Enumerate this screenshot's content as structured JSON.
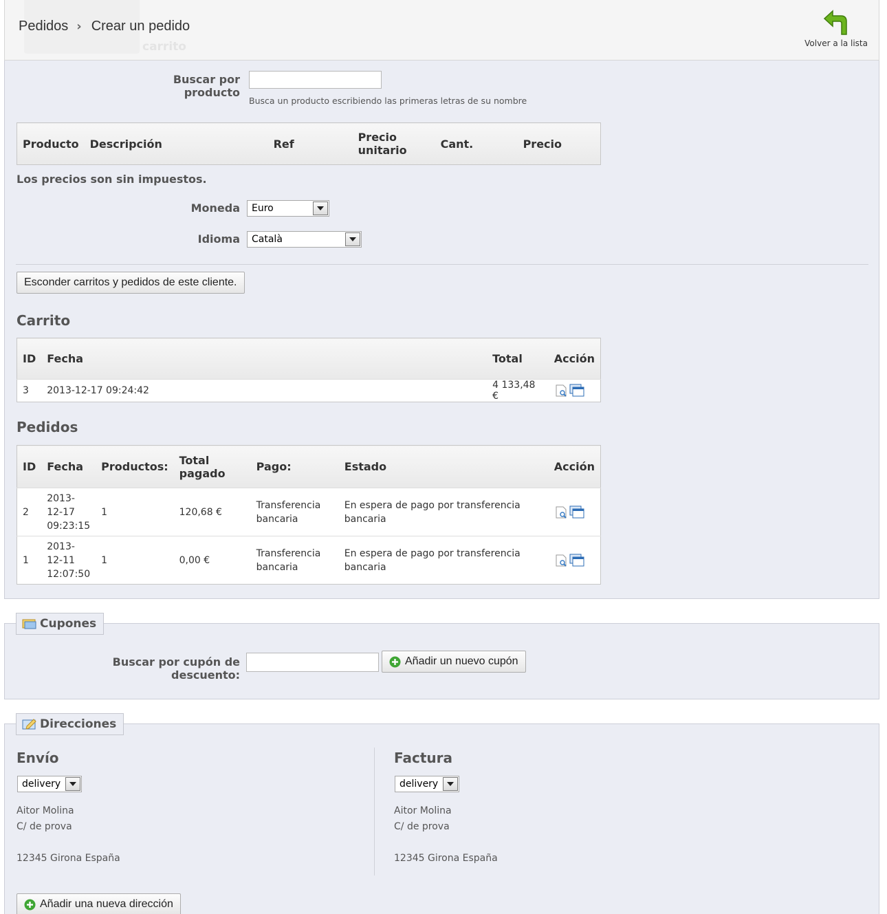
{
  "header": {
    "breadcrumb_parent": "Pedidos",
    "breadcrumb_current": "Crear un pedido",
    "ghost_text": "carrito",
    "back_label": "Volver a la lista"
  },
  "product_search": {
    "label": "Buscar por producto",
    "value": "",
    "hint": "Busca un producto escribiendo las primeras letras de su nombre"
  },
  "products_table": {
    "headers": [
      "Producto",
      "Descripción",
      "Ref",
      "Precio unitario",
      "Cant.",
      "Precio"
    ]
  },
  "tax_note": "Los precios son sin impuestos.",
  "currency": {
    "label": "Moneda",
    "value": "Euro"
  },
  "language": {
    "label": "Idioma",
    "value": "Català"
  },
  "toggle_button": "Esconder carritos y pedidos de este cliente.",
  "carts": {
    "title": "Carrito",
    "headers": [
      "ID",
      "Fecha",
      "Total",
      "Acción"
    ],
    "rows": [
      {
        "id": "3",
        "date": "2013-12-17 09:24:42",
        "total": "4 133,48 €"
      }
    ]
  },
  "orders": {
    "title": "Pedidos",
    "headers": [
      "ID",
      "Fecha",
      "Productos:",
      "Total pagado",
      "Pago:",
      "Estado",
      "Acción"
    ],
    "rows": [
      {
        "id": "2",
        "date_l1": "2013-",
        "date_l2": "12-17",
        "date_l3": "09:23:15",
        "products": "1",
        "total": "120,68 €",
        "payment_l1": "Transferencia",
        "payment_l2": "bancaria",
        "status_l1": "En espera de pago por transferencia",
        "status_l2": "bancaria"
      },
      {
        "id": "1",
        "date_l1": "2013-",
        "date_l2": "12-11",
        "date_l3": "12:07:50",
        "products": "1",
        "total": "0,00 €",
        "payment_l1": "Transferencia",
        "payment_l2": "bancaria",
        "status_l1": "En espera de pago por transferencia",
        "status_l2": "bancaria"
      }
    ]
  },
  "vouchers": {
    "legend": "Cupones",
    "search_label": "Buscar por cupón de descuento:",
    "value": "",
    "add_button": "Añadir un nuevo cupón"
  },
  "addresses": {
    "legend": "Direcciones",
    "delivery": {
      "title": "Envío",
      "select": "delivery",
      "name": "Aitor Molina",
      "street": "C/ de prova",
      "city": "12345 Girona España"
    },
    "invoice": {
      "title": "Factura",
      "select": "delivery",
      "name": "Aitor Molina",
      "street": "C/ de prova",
      "city": "12345 Girona España"
    },
    "add_button": "Añadir una nueva dirección"
  },
  "colors": {
    "panel_bg": "#ebedf4",
    "header_bg": "#f5f5f5",
    "back_arrow": "#6cb41e",
    "add_icon": "#3fa634"
  }
}
